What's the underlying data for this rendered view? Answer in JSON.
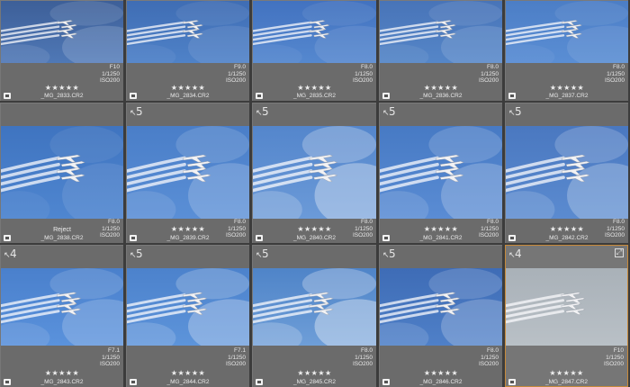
{
  "grid": {
    "rows": [
      {
        "cells": [
          {
            "name": "_MG_2833.CR2",
            "badge": "",
            "aperture": "F10",
            "shutter": "1/1250",
            "iso": "ISO200",
            "flag": "",
            "stars": "★★★★★",
            "sky": "#4f78b6",
            "skyTop": "#3d5f98",
            "cloud": 0.25,
            "selected": false
          },
          {
            "name": "_MG_2834.CR2",
            "badge": "",
            "aperture": "F9.0",
            "shutter": "1/1250",
            "iso": "ISO200",
            "flag": "",
            "stars": "★★★★★",
            "sky": "#4f82c8",
            "skyTop": "#3f6db4",
            "cloud": 0.15,
            "selected": false
          },
          {
            "name": "_MG_2835.CR2",
            "badge": "",
            "aperture": "F8.0",
            "shutter": "1/1250",
            "iso": "ISO200",
            "flag": "",
            "stars": "★★★★★",
            "sky": "#5588cf",
            "skyTop": "#4272c0",
            "cloud": 0.15,
            "selected": false
          },
          {
            "name": "_MG_2836.CR2",
            "badge": "",
            "aperture": "F8.0",
            "shutter": "1/1250",
            "iso": "ISO200",
            "flag": "",
            "stars": "★★★★★",
            "sky": "#5586c8",
            "skyTop": "#4874b8",
            "cloud": 0.2,
            "selected": false
          },
          {
            "name": "_MG_2837.CR2",
            "badge": "",
            "aperture": "F8.0",
            "shutter": "1/1250",
            "iso": "ISO200",
            "flag": "",
            "stars": "★★★★★",
            "sky": "#5a8ed4",
            "skyTop": "#4c7ec6",
            "cloud": 0.15,
            "selected": false
          }
        ]
      },
      {
        "cells": [
          {
            "name": "_MG_2838.CR2",
            "badge": "",
            "aperture": "F8.0",
            "shutter": "1/1250",
            "iso": "ISO200",
            "flag": "Reject",
            "stars": "",
            "sky": "#4f86d0",
            "skyTop": "#3f74c0",
            "cloud": 0.15,
            "selected": false
          },
          {
            "name": "_MG_2839.CR2",
            "badge": "5",
            "aperture": "F8.0",
            "shutter": "1/1250",
            "iso": "ISO200",
            "flag": "",
            "stars": "★★★★★",
            "sky": "#5a8fd6",
            "skyTop": "#4a7ec8",
            "cloud": 0.3,
            "selected": false
          },
          {
            "name": "_MG_2840.CR2",
            "badge": "5",
            "aperture": "F8.0",
            "shutter": "1/1250",
            "iso": "ISO200",
            "flag": "",
            "stars": "★★★★★",
            "sky": "#6b9ad8",
            "skyTop": "#5486cc",
            "cloud": 0.55,
            "selected": false
          },
          {
            "name": "_MG_2841.CR2",
            "badge": "5",
            "aperture": "F8.0",
            "shutter": "1/1250",
            "iso": "ISO200",
            "flag": "",
            "stars": "★★★★★",
            "sky": "#5a8cd4",
            "skyTop": "#477ac4",
            "cloud": 0.35,
            "selected": false
          },
          {
            "name": "_MG_2842.CR2",
            "badge": "5",
            "aperture": "F8.0",
            "shutter": "1/1250",
            "iso": "ISO200",
            "flag": "",
            "stars": "★★★★★",
            "sky": "#5b8bd0",
            "skyTop": "#4a78c0",
            "cloud": 0.4,
            "selected": false
          }
        ]
      },
      {
        "cells": [
          {
            "name": "_MG_2843.CR2",
            "badge": "4",
            "aperture": "F7.1",
            "shutter": "1/1250",
            "iso": "ISO200",
            "flag": "",
            "stars": "★★★★★",
            "sky": "#5a92dc",
            "skyTop": "#4a80cc",
            "cloud": 0.3,
            "selected": false
          },
          {
            "name": "_MG_2844.CR2",
            "badge": "5",
            "aperture": "F7.1",
            "shutter": "1/1250",
            "iso": "ISO200",
            "flag": "",
            "stars": "★★★★★",
            "sky": "#5d94da",
            "skyTop": "#4c82cc",
            "cloud": 0.45,
            "selected": false
          },
          {
            "name": "_MG_2845.CR2",
            "badge": "5",
            "aperture": "F8.0",
            "shutter": "1/1250",
            "iso": "ISO200",
            "flag": "",
            "stars": "★★★★★",
            "sky": "#6e9ed8",
            "skyTop": "#4f84c8",
            "cloud": 0.6,
            "selected": false
          },
          {
            "name": "_MG_2846.CR2",
            "badge": "5",
            "aperture": "F8.0",
            "shutter": "1/1250",
            "iso": "ISO200",
            "flag": "",
            "stars": "★★★★★",
            "sky": "#4f80c8",
            "skyTop": "#3e6cb6",
            "cloud": 0.35,
            "selected": false
          },
          {
            "name": "_MG_2847.CR2",
            "badge": "4",
            "aperture": "F10",
            "shutter": "1/1250",
            "iso": "ISO200",
            "flag": "",
            "stars": "★★★★★",
            "sky": "#b9c0c6",
            "skyTop": "#a9b1b8",
            "cloud": 0.0,
            "selected": true
          }
        ]
      }
    ]
  },
  "colors": {
    "background": "#3c3c3c",
    "cell": "#6b6b6b",
    "selection": "#c88a3a"
  },
  "icons": {
    "stack-badge": "arrow-stack-icon",
    "file-type": "document-icon",
    "zoom": "expand-icon"
  }
}
